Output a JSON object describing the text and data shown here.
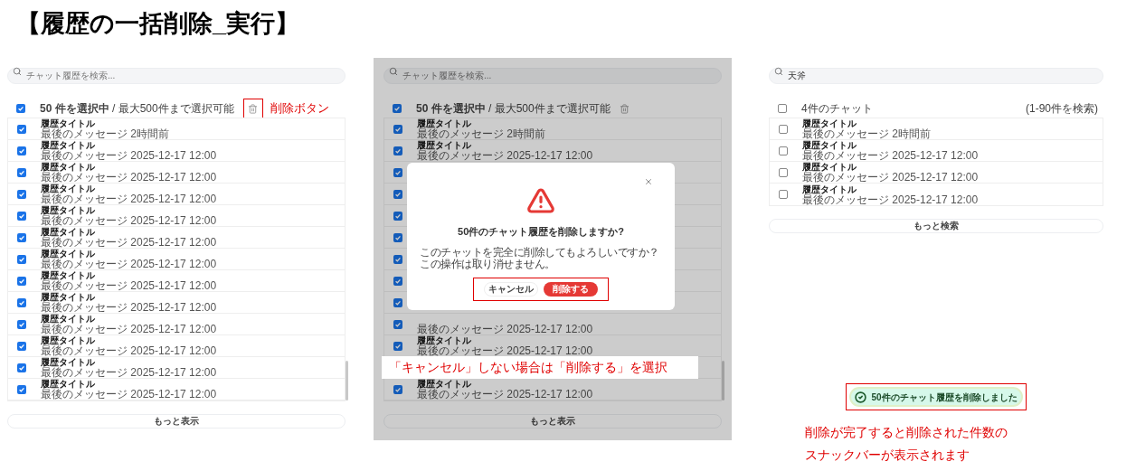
{
  "page_title": "【履歴の一括削除_実行】",
  "selection_view": {
    "search": {
      "placeholder": "チャット履歴を検索..."
    },
    "header": {
      "checked": true,
      "label": "**50 件を選択中** / 最大500件まで選択可能"
    },
    "annotation": "削除ボタン",
    "rows": [
      {
        "checked": true,
        "title": "履歴タイトル",
        "subtitle": "最後のメッセージ 2時間前"
      },
      {
        "checked": true,
        "title": "履歴タイトル",
        "subtitle": "最後のメッセージ 2025-12-17 12:00"
      },
      {
        "checked": true,
        "title": "履歴タイトル",
        "subtitle": "最後のメッセージ 2025-12-17 12:00"
      },
      {
        "checked": true,
        "title": "履歴タイトル",
        "subtitle": "最後のメッセージ 2025-12-17 12:00"
      },
      {
        "checked": true,
        "title": "履歴タイトル",
        "subtitle": "最後のメッセージ 2025-12-17 12:00"
      },
      {
        "checked": true,
        "title": "履歴タイトル",
        "subtitle": "最後のメッセージ 2025-12-17 12:00"
      },
      {
        "checked": true,
        "title": "履歴タイトル",
        "subtitle": "最後のメッセージ 2025-12-17 12:00"
      },
      {
        "checked": true,
        "title": "履歴タイトル",
        "subtitle": "最後のメッセージ 2025-12-17 12:00"
      },
      {
        "checked": true,
        "title": "履歴タイトル",
        "subtitle": "最後のメッセージ 2025-12-17 12:00"
      },
      {
        "checked": true,
        "title": "履歴タイトル",
        "subtitle": "最後のメッセージ 2025-12-17 12:00"
      },
      {
        "checked": true,
        "title": "履歴タイトル",
        "subtitle": "最後のメッセージ 2025-12-17 12:00"
      },
      {
        "checked": true,
        "title": "履歴タイトル",
        "subtitle": "最後のメッセージ 2025-12-17 12:00"
      },
      {
        "checked": true,
        "title": "履歴タイトル",
        "subtitle": "最後のメッセージ 2025-12-17 12:00"
      }
    ],
    "more_button": "もっと表示"
  },
  "confirm_view": {
    "search": {
      "placeholder": "チャット履歴を検索..."
    },
    "header": {
      "checked": true,
      "label": "**50 件を選択中** / 最大500件まで選択可能"
    },
    "rows": [
      {
        "kind": "item",
        "checked": true,
        "title": "履歴タイトル",
        "subtitle": "最後のメッセージ 2時間前"
      },
      {
        "kind": "item",
        "checked": true,
        "title": "履歴タイトル",
        "subtitle": "最後のメッセージ 2025-12-17 12:00"
      },
      {
        "kind": "checkbox_only",
        "checked": true
      },
      {
        "kind": "checkbox_only",
        "checked": true
      },
      {
        "kind": "checkbox_only",
        "checked": true
      },
      {
        "kind": "checkbox_only",
        "checked": true
      },
      {
        "kind": "checkbox_only",
        "checked": true
      },
      {
        "kind": "checkbox_only",
        "checked": true
      },
      {
        "kind": "checkbox_only",
        "checked": true
      },
      {
        "kind": "subtitle_only",
        "checked": true,
        "subtitle": "最後のメッセージ 2025-12-17 12:00"
      },
      {
        "kind": "item",
        "checked": true,
        "title": "履歴タイトル",
        "subtitle": "最後のメッセージ 2025-12-17 12:00"
      },
      {
        "kind": "covered"
      },
      {
        "kind": "item",
        "checked": true,
        "title": "履歴タイトル",
        "subtitle": "最後のメッセージ 2025-12-17 12:00"
      }
    ],
    "more_button": "もっと表示",
    "dialog": {
      "title": "50件のチャット履歴を削除しますか?",
      "body": [
        "このチャットを完全に削除してもよろしいですか？",
        "この操作は取り消せません。"
      ],
      "cancel": "キャンセル",
      "confirm": "削除する"
    },
    "annotation": "「キャンセル」しない場合は「削除する」を選択"
  },
  "result_view": {
    "search": {
      "value": "天斧"
    },
    "header": {
      "checked": false,
      "label": "4件のチャット",
      "count": "(1-90件を検索)"
    },
    "rows": [
      {
        "checked": false,
        "title": "履歴タイトル",
        "subtitle": "最後のメッセージ 2時間前"
      },
      {
        "checked": false,
        "title": "履歴タイトル",
        "subtitle": "最後のメッセージ 2025-12-17 12:00"
      },
      {
        "checked": false,
        "title": "履歴タイトル",
        "subtitle": "最後のメッセージ 2025-12-17 12:00"
      },
      {
        "checked": false,
        "title": "履歴タイトル",
        "subtitle": "最後のメッセージ 2025-12-17 12:00"
      }
    ],
    "more_button": "もっと検索",
    "snackbar": {
      "message": "50件のチャット履歴を削除しました"
    },
    "annotation": [
      "削除が完了すると削除された件数の",
      "スナックバーが表示されます"
    ]
  }
}
